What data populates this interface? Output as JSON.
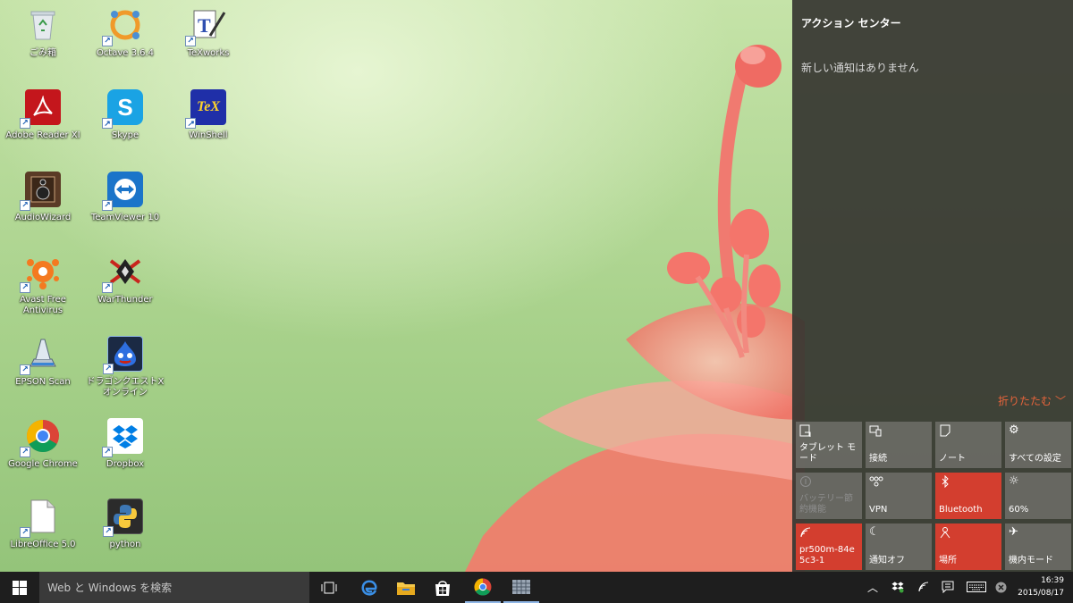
{
  "desktop": {
    "icons": [
      {
        "label": "ごみ箱",
        "icon": "recycle-bin-icon"
      },
      {
        "label": "Octave 3.6.4",
        "icon": "octave-icon"
      },
      {
        "label": "TeXworks",
        "icon": "texworks-icon"
      },
      {
        "label": "Adobe Reader XI",
        "icon": "adobe-reader-icon"
      },
      {
        "label": "Skype",
        "icon": "skype-icon"
      },
      {
        "label": "WinShell",
        "icon": "winshell-icon"
      },
      {
        "label": "AudioWizard",
        "icon": "audiowizard-icon"
      },
      {
        "label": "TeamViewer 10",
        "icon": "teamviewer-icon"
      },
      {
        "label": "Avast Free\nAntivirus",
        "icon": "avast-icon"
      },
      {
        "label": "WarThunder",
        "icon": "warthunder-icon"
      },
      {
        "label": "EPSON Scan",
        "icon": "epson-scan-icon"
      },
      {
        "label": "ドラゴンクエストX\nオンライン",
        "icon": "dragon-quest-icon"
      },
      {
        "label": "Google Chrome",
        "icon": "chrome-icon"
      },
      {
        "label": "Dropbox",
        "icon": "dropbox-icon"
      },
      {
        "label": "LibreOffice 5.0",
        "icon": "libreoffice-icon"
      },
      {
        "label": "python",
        "icon": "python-icon"
      }
    ]
  },
  "action_center": {
    "title": "アクション センター",
    "no_notifications": "新しい通知はありません",
    "collapse_label": "折りたたむ",
    "quick_actions": [
      {
        "label": "タブレット モード",
        "icon": "tablet-mode-icon",
        "state": "off"
      },
      {
        "label": "接続",
        "icon": "connect-icon",
        "state": "off"
      },
      {
        "label": "ノート",
        "icon": "note-icon",
        "state": "off"
      },
      {
        "label": "すべての設定",
        "icon": "gear-icon",
        "state": "off"
      },
      {
        "label": "バッテリー節約機能",
        "icon": "battery-saver-icon",
        "state": "disabled"
      },
      {
        "label": "VPN",
        "icon": "vpn-icon",
        "state": "off"
      },
      {
        "label": "Bluetooth",
        "icon": "bluetooth-icon",
        "state": "on"
      },
      {
        "label": "60%",
        "icon": "brightness-icon",
        "state": "off"
      },
      {
        "label": "pr500m-84e5c3-1",
        "icon": "wifi-icon",
        "state": "on"
      },
      {
        "label": "通知オフ",
        "icon": "quiet-hours-icon",
        "state": "off"
      },
      {
        "label": "場所",
        "icon": "location-icon",
        "state": "on"
      },
      {
        "label": "機内モード",
        "icon": "airplane-icon",
        "state": "off"
      }
    ]
  },
  "taskbar": {
    "search_placeholder": "Web と Windows を検索",
    "apps": [
      "task-view-icon",
      "edge-icon",
      "file-explorer-icon",
      "store-icon",
      "chrome-icon",
      "app-icon"
    ],
    "clock_time": "16:39",
    "clock_date": "2015/08/17"
  },
  "colors": {
    "accent": "#d33e2f",
    "collapse_link": "#e8643b",
    "taskbar": "#1e1e1e"
  }
}
